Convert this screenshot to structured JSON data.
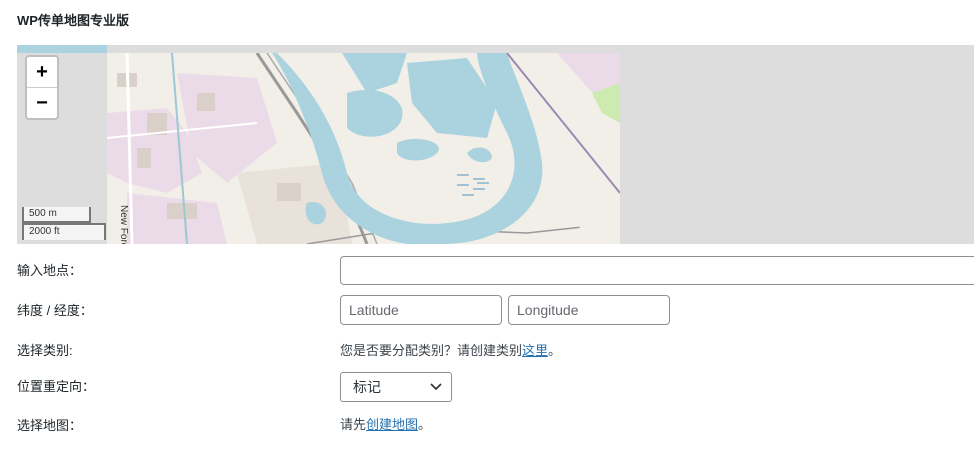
{
  "plugin_title": "WP传单地图专业版",
  "map": {
    "zoom_in": "+",
    "zoom_out": "−",
    "scale_metric": "500 m",
    "scale_imperial": "2000 ft",
    "street_label": "New Ford",
    "colors": {
      "water": "#aad3df",
      "land": "#f2efe9",
      "industrial": "#ebdbe8",
      "grass": "#cdebb0"
    }
  },
  "form": {
    "location_label": "输入地点：",
    "location_value": "",
    "latlng_label": "纬度 / 经度：",
    "lat_placeholder": "Latitude",
    "lng_placeholder": "Longitude",
    "category_label": "选择类别:",
    "category_text": "您是否要分配类别？请创建类别",
    "category_link": "这里",
    "category_suffix": "。",
    "redirect_label": "位置重定向：",
    "redirect_value": "标记",
    "choose_map_label": "选择地图：",
    "choose_map_prefix": "请先",
    "choose_map_link": "创建地图",
    "choose_map_suffix": "。"
  }
}
